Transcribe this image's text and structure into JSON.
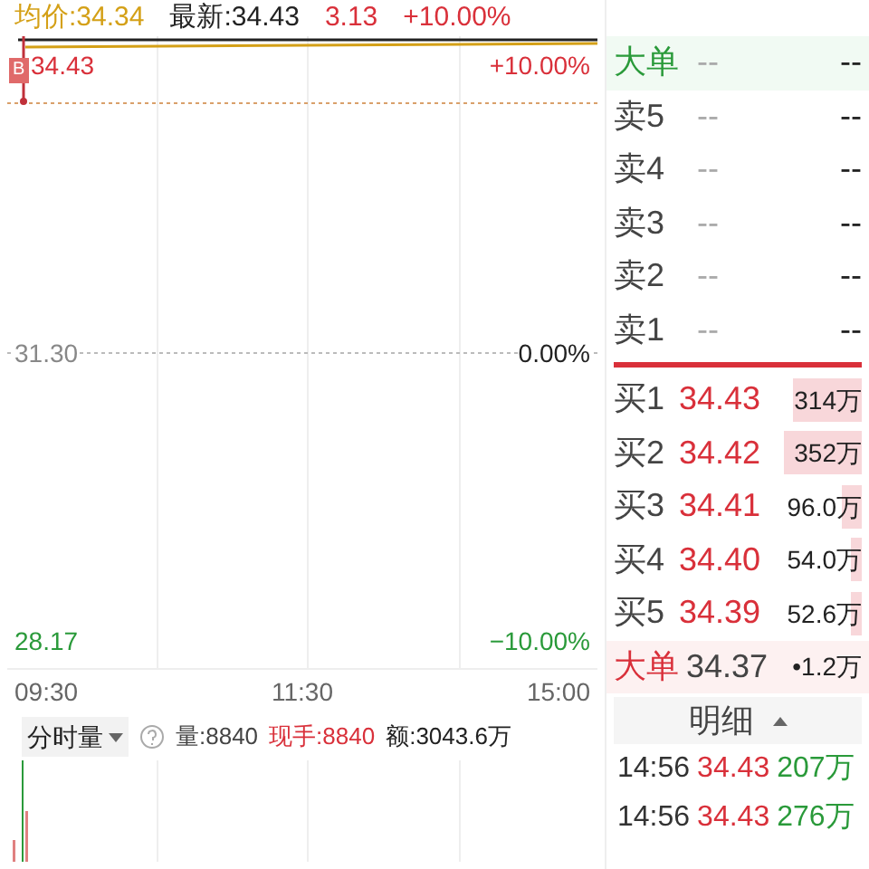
{
  "header": {
    "avg_price": "均价:34.34",
    "latest": "最新:34.43",
    "change": "3.13",
    "change_pct": "+10.00%"
  },
  "chart": {
    "badge": "B",
    "top_price": "34.43",
    "top_pct": "+10.00%",
    "mid_price": "31.30",
    "mid_pct": "0.00%",
    "bottom_price": "28.17",
    "bottom_pct": "−10.00%",
    "times": [
      "09:30",
      "11:30",
      "15:00"
    ]
  },
  "volume": {
    "selector": "分时量",
    "volume": "量:8840",
    "current": "现手:8840",
    "amount": "额:3043.6万"
  },
  "order_book": {
    "large_top": {
      "label": "大单",
      "price": "--",
      "volume": "--"
    },
    "asks": [
      {
        "label": "卖5",
        "price": "--",
        "volume": "--"
      },
      {
        "label": "卖4",
        "price": "--",
        "volume": "--"
      },
      {
        "label": "卖3",
        "price": "--",
        "volume": "--"
      },
      {
        "label": "卖2",
        "price": "--",
        "volume": "--"
      },
      {
        "label": "卖1",
        "price": "--",
        "volume": "--"
      }
    ],
    "bids": [
      {
        "label": "买1",
        "price": "34.43",
        "volume": "314万"
      },
      {
        "label": "买2",
        "price": "34.42",
        "volume": "352万"
      },
      {
        "label": "买3",
        "price": "34.41",
        "volume": "96.0万"
      },
      {
        "label": "买4",
        "price": "34.40",
        "volume": "54.0万"
      },
      {
        "label": "买5",
        "price": "34.39",
        "volume": "52.6万"
      }
    ],
    "large_bottom": {
      "label": "大单",
      "price": "34.37",
      "volume": "•1.2万"
    }
  },
  "details": {
    "title": "明细",
    "trades": [
      {
        "time": "14:56",
        "price": "34.43",
        "amount": "207万"
      },
      {
        "time": "14:56",
        "price": "34.43",
        "amount": "276万"
      }
    ]
  }
}
